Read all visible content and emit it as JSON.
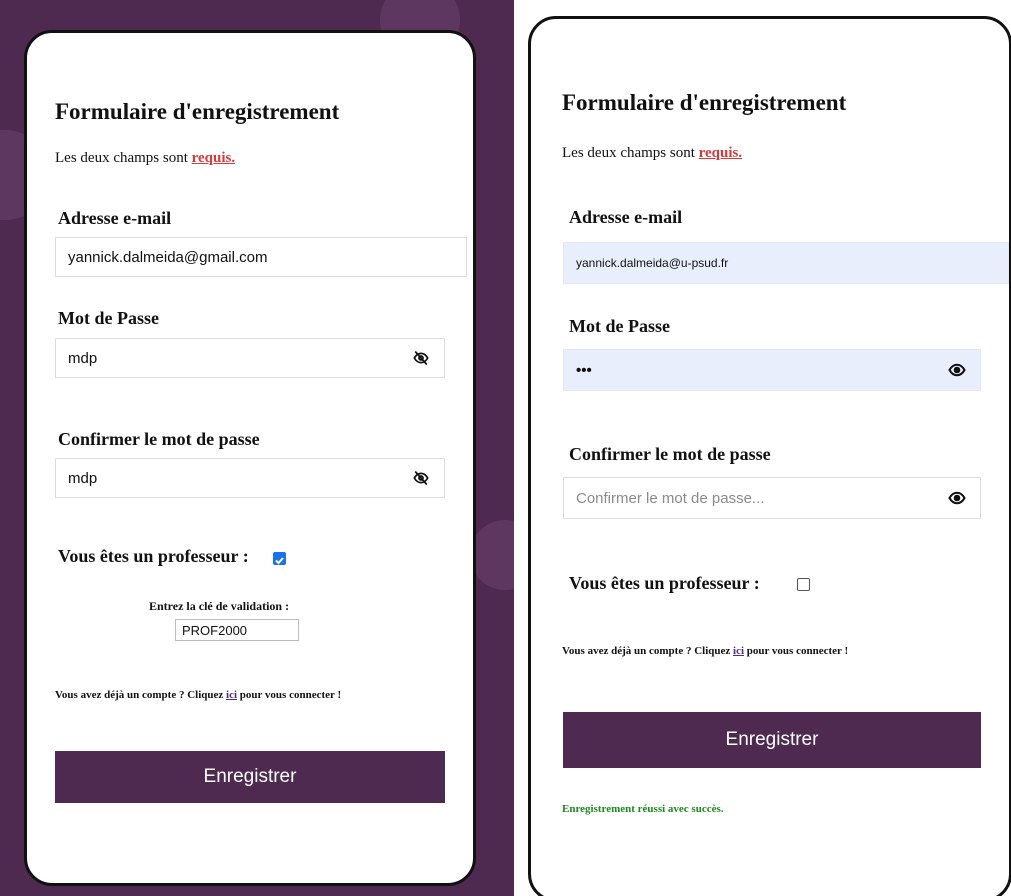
{
  "colors": {
    "brand": "#4f2a50",
    "error": "#d63a3a",
    "success": "#1e8a1e",
    "link": "#4b2a8a"
  },
  "left": {
    "title": "Formulaire d'enregistrement",
    "subtitle_prefix": "Les deux champs sont ",
    "required_link": "requis.",
    "email_label": "Adresse e-mail",
    "email_value": "yannick.dalmeida@gmail.com",
    "password_label": "Mot de Passe",
    "password_value": "mdp",
    "confirm_label": "Confirmer le mot de passe",
    "confirm_value": "mdp",
    "professor_label": "Vous êtes un professeur :",
    "professor_checked": true,
    "validation_label": "Entrez la clé de validation :",
    "validation_value": "PROF2000",
    "login_prefix": "Vous avez déjà un compte ? Cliquez ",
    "login_link": "ici",
    "login_suffix": " pour vous connecter !",
    "submit_label": "Enregistrer",
    "eye_icon": "eye-slash-icon"
  },
  "right": {
    "title": "Formulaire d'enregistrement",
    "subtitle_prefix": "Les deux champs sont ",
    "required_link": "requis.",
    "email_label": "Adresse e-mail",
    "email_value": "yannick.dalmeida@u-psud.fr",
    "password_label": "Mot de Passe",
    "password_value": "•••",
    "confirm_label": "Confirmer le mot de passe",
    "confirm_placeholder": "Confirmer le mot de passe...",
    "professor_label": "Vous êtes un professeur :",
    "professor_checked": false,
    "login_prefix": "Vous avez déjà un compte ? Cliquez ",
    "login_link": "ici",
    "login_suffix": " pour vous connecter !",
    "submit_label": "Enregistrer",
    "success_message": "Enregistrement réussi avec succès.",
    "eye_icon": "eye-icon"
  }
}
